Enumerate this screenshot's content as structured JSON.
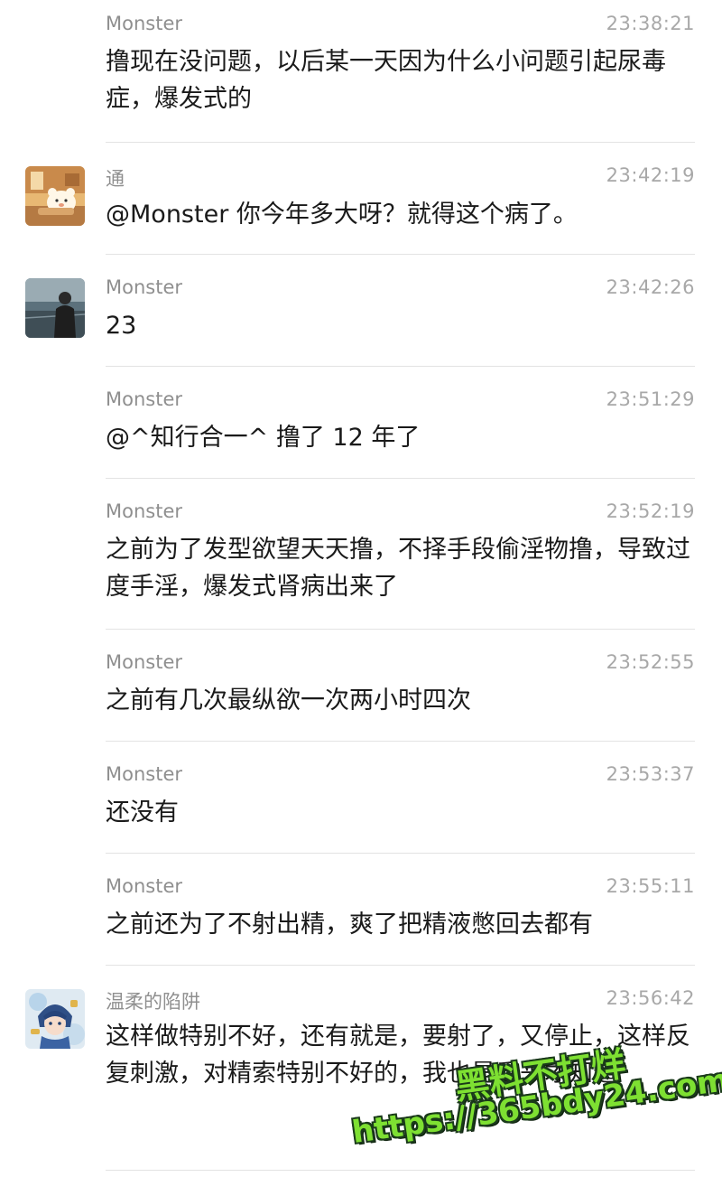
{
  "messages": [
    {
      "sender": "Monster",
      "time": "23:38:21",
      "text": "撸现在没问题，以后某一天因为什么小问题引起尿毒症，爆发式的",
      "avatar": null
    },
    {
      "sender": "通",
      "time": "23:42:19",
      "text": "@Monster 你今年多大呀？就得这个病了。",
      "avatar": "cartoon-bear-avatar"
    },
    {
      "sender": "Monster",
      "time": "23:42:26",
      "text": "23",
      "avatar": "person-photo-avatar"
    },
    {
      "sender": "Monster",
      "time": "23:51:29",
      "text": "@^知行合一^ 撸了 12 年了",
      "avatar": null
    },
    {
      "sender": "Monster",
      "time": "23:52:19",
      "text": "之前为了发型欲望天天撸，不择手段偷淫物撸，导致过度手淫，爆发式肾病出来了",
      "avatar": null
    },
    {
      "sender": "Monster",
      "time": "23:52:55",
      "text": "之前有几次最纵欲一次两小时四次",
      "avatar": null
    },
    {
      "sender": "Monster",
      "time": "23:53:37",
      "text": "还没有",
      "avatar": null
    },
    {
      "sender": "Monster",
      "time": "23:55:11",
      "text": "之前还为了不射出精，爽了把精液憋回去都有",
      "avatar": null
    },
    {
      "sender": "温柔的陷阱",
      "time": "23:56:42",
      "text": "这样做特别不好，还有就是，要射了，又停止，这样反复刺激，对精索特别不好的，我也是后来才知道",
      "avatar": "anime-character-avatar"
    }
  ],
  "watermark": {
    "line1": "黑料不打烊",
    "line2": "https://365bdy24.com",
    "color": "#7ee032"
  }
}
